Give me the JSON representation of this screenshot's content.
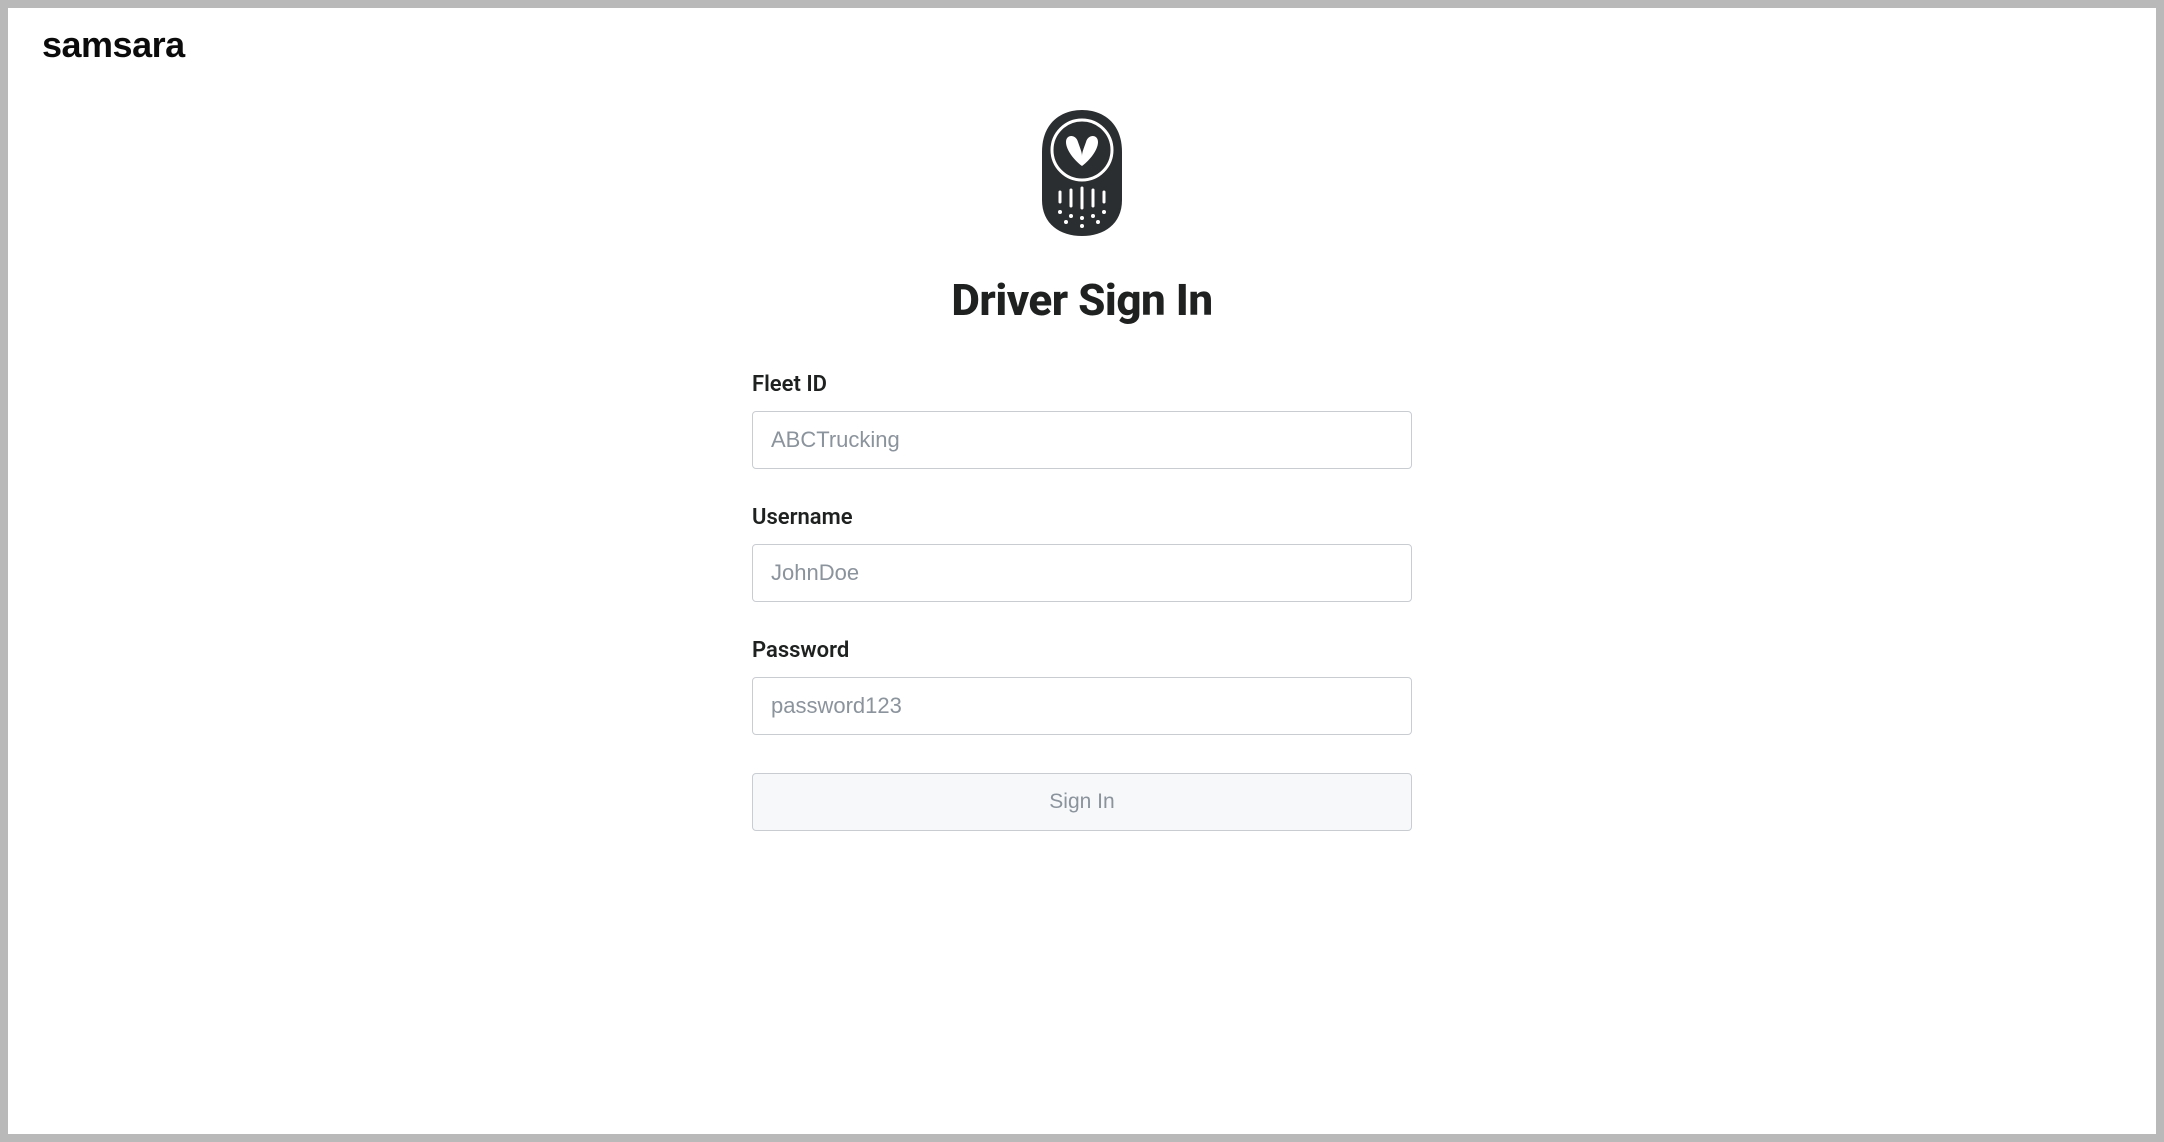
{
  "brand": "samsara",
  "page": {
    "title": "Driver Sign In"
  },
  "form": {
    "fleet_id": {
      "label": "Fleet ID",
      "placeholder": "ABCTrucking",
      "value": ""
    },
    "username": {
      "label": "Username",
      "placeholder": "JohnDoe",
      "value": ""
    },
    "password": {
      "label": "Password",
      "placeholder": "password123",
      "value": ""
    },
    "submit_label": "Sign In"
  },
  "colors": {
    "border_gray": "#c9cdd2",
    "text_dark": "#1f2121",
    "placeholder": "#8b939c",
    "btn_bg": "#f6f8fa",
    "logo_dark": "#2b2e30"
  }
}
